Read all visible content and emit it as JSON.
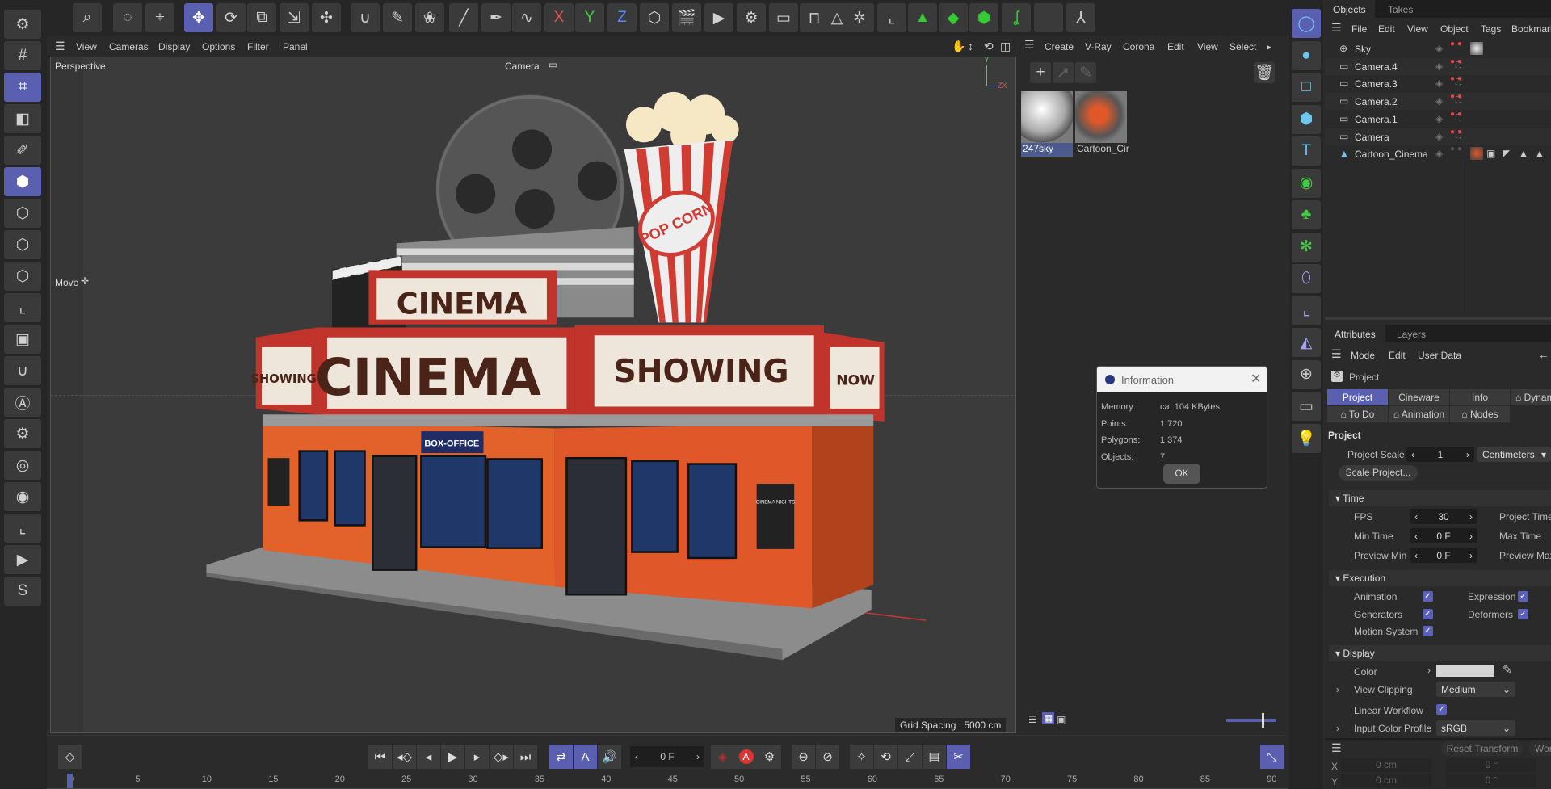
{
  "top_toolbar": [
    {
      "name": "search-icon",
      "g": "⌕"
    },
    {
      "name": "live-selection-icon",
      "g": "◌"
    },
    {
      "name": "selection-tool-icon",
      "g": "⌖"
    },
    {
      "name": "move-icon",
      "g": "✥",
      "active": true
    },
    {
      "name": "rotate-icon",
      "g": "⟳"
    },
    {
      "name": "scale-icon",
      "g": "⧉"
    },
    {
      "name": "snap-move-icon",
      "g": "⇲"
    },
    {
      "name": "transform-icon",
      "g": "✣"
    },
    {
      "name": "magnet-icon",
      "g": "∪"
    },
    {
      "name": "paint-icon",
      "g": "✎"
    },
    {
      "name": "weight-icon",
      "g": "❀"
    },
    {
      "name": "brush-icon",
      "g": "╱"
    },
    {
      "name": "pen-icon",
      "g": "✒"
    },
    {
      "name": "spline-icon",
      "g": "∿"
    },
    {
      "name": "x-axis-icon",
      "g": "X"
    },
    {
      "name": "y-axis-icon",
      "g": "Y"
    },
    {
      "name": "z-axis-icon",
      "g": "Z"
    },
    {
      "name": "coordinate-system-icon",
      "g": "⬡"
    },
    {
      "name": "render-view-icon",
      "g": "🎬"
    },
    {
      "name": "render-picture-viewer-icon",
      "g": "▶"
    },
    {
      "name": "render-settings-icon",
      "g": "⚙"
    },
    {
      "name": "render-queue-icon",
      "g": "▭"
    },
    {
      "name": "lock-icon",
      "g": "⊓"
    },
    {
      "name": "triangle-tag-icon",
      "g": "△"
    },
    {
      "name": "sparkle-icon",
      "g": "✲"
    },
    {
      "name": "axis-icon",
      "g": "⌞"
    },
    {
      "name": "green-pyramid-icon",
      "g": "▲"
    },
    {
      "name": "green-cube-icon",
      "g": "◆"
    },
    {
      "name": "green-cube2-icon",
      "g": "⬢"
    },
    {
      "name": "green-spline-icon",
      "g": "ʆ"
    },
    {
      "name": "empty-slot-icon",
      "g": ""
    },
    {
      "name": "figure-icon",
      "g": "⅄"
    }
  ],
  "left_toolbar": [
    {
      "name": "settings-icon",
      "g": "⚙"
    },
    {
      "name": "grid-icon",
      "g": "#"
    },
    {
      "name": "workplane-icon",
      "g": "⌗",
      "active": true
    },
    {
      "name": "model-mode-icon",
      "g": "◧"
    },
    {
      "name": "sculpt-icon",
      "g": "✐"
    },
    {
      "name": "object-mode-icon",
      "g": "⬢",
      "active": true
    },
    {
      "name": "points-mode-icon",
      "g": "⬡"
    },
    {
      "name": "edges-mode-icon",
      "g": "⬡"
    },
    {
      "name": "polygons-mode-icon",
      "g": "⬡"
    },
    {
      "name": "axis-mode-icon",
      "g": "⌞"
    },
    {
      "name": "texture-mode-icon",
      "g": "▣"
    },
    {
      "name": "magnet-snap-icon",
      "g": "∪"
    },
    {
      "name": "auto-snap-icon",
      "g": "Ⓐ"
    },
    {
      "name": "snap-settings-icon",
      "g": "⚙"
    },
    {
      "name": "symmetry-icon",
      "g": "◎"
    },
    {
      "name": "visibility-icon",
      "g": "◉"
    },
    {
      "name": "texture-axis-icon",
      "g": "⌞"
    },
    {
      "name": "render-region-icon",
      "g": "▶"
    },
    {
      "name": "s-plugin-icon",
      "g": "S"
    }
  ],
  "right_column": [
    {
      "name": "sky-object-icon",
      "g": "◯",
      "active": true
    },
    {
      "name": "null-object-icon",
      "g": "●"
    },
    {
      "name": "spline-rect-icon",
      "g": "□"
    },
    {
      "name": "cube-icon",
      "g": "⬢"
    },
    {
      "name": "text-icon",
      "g": "T"
    },
    {
      "name": "generator-icon",
      "g": "◉"
    },
    {
      "name": "cloner-icon",
      "g": "♣"
    },
    {
      "name": "effector-icon",
      "g": "✻"
    },
    {
      "name": "deformer-icon",
      "g": "⬯"
    },
    {
      "name": "field-icon",
      "g": "⌞"
    },
    {
      "name": "tag-icon",
      "g": "◭"
    },
    {
      "name": "environment-icon",
      "g": "⊕"
    },
    {
      "name": "camera-icon",
      "g": "▭"
    },
    {
      "name": "light-icon",
      "g": "💡"
    }
  ],
  "viewport": {
    "menu": [
      "View",
      "Cameras",
      "Display",
      "Options",
      "Filter",
      "Panel"
    ],
    "view_name": "Perspective",
    "camera": "Camera",
    "tool_label": "Move",
    "grid_spacing": "Grid Spacing : 5000 cm",
    "axis_y": "Y",
    "axis_zx": "ZX"
  },
  "scene": {
    "sign_main": "CINEMA",
    "sign_top": "CINEMA",
    "sign_showing": "SHOWING",
    "sign_left": "SHOWING",
    "sign_now": "NOW",
    "box_office": "BOX-OFFICE",
    "popcorn": "POP CORN",
    "poster": "CINEMA NIGHTS"
  },
  "materials": {
    "menu": [
      "Create",
      "V-Ray",
      "Corona",
      "Edit",
      "View",
      "Select"
    ],
    "items": [
      {
        "name": "247sky",
        "selected": true
      },
      {
        "name": "Cartoon_Cir"
      }
    ]
  },
  "info_dialog": {
    "title": "Information",
    "rows": [
      {
        "k": "Memory:",
        "v": "ca. 104 KBytes"
      },
      {
        "k": "Points:",
        "v": "1 720"
      },
      {
        "k": "Polygons:",
        "v": "1 374"
      },
      {
        "k": "Objects:",
        "v": "7"
      }
    ],
    "ok": "OK"
  },
  "objects": {
    "tabs": [
      "Objects",
      "Takes"
    ],
    "menu": [
      "File",
      "Edit",
      "View",
      "Object",
      "Tags",
      "Bookmarks"
    ],
    "rows": [
      {
        "name": "Sky",
        "icon": "⊕"
      },
      {
        "name": "Camera.4",
        "icon": "▭"
      },
      {
        "name": "Camera.3",
        "icon": "▭"
      },
      {
        "name": "Camera.2",
        "icon": "▭"
      },
      {
        "name": "Camera.1",
        "icon": "▭"
      },
      {
        "name": "Camera",
        "icon": "▭"
      },
      {
        "name": "Cartoon_Cinema",
        "icon": "▲"
      }
    ]
  },
  "attributes": {
    "tabs": [
      "Attributes",
      "Layers"
    ],
    "menu": [
      "Mode",
      "Edit",
      "User Data"
    ],
    "object": "Project",
    "subtabs1": [
      "Project",
      "Cineware",
      "Info",
      "⌂ Dynamics"
    ],
    "subtabs2": [
      "⌂ To Do",
      "⌂ Animation",
      "⌂ Nodes"
    ],
    "heading": "Project",
    "project_scale_label": "Project Scale",
    "project_scale": "1",
    "units": "Centimeters",
    "scale_button": "Scale Project...",
    "time": {
      "title": "Time",
      "fps_label": "FPS",
      "fps": "30",
      "min_label": "Min Time",
      "min": "0 F",
      "pmin_label": "Preview Min",
      "pmin": "0 F",
      "ptime_label": "Project Time",
      "max_label": "Max Time",
      "pmax_label": "Preview Max"
    },
    "execution": {
      "title": "Execution",
      "items": [
        "Animation",
        "Generators",
        "Motion System",
        "Expression",
        "Deformers"
      ]
    },
    "display": {
      "title": "Display",
      "color_label": "Color",
      "color": "#d4d4d4",
      "clip_label": "View Clipping",
      "clip": "Medium",
      "linear_label": "Linear Workflow",
      "input_label": "Input Color Profile",
      "input": "sRGB"
    }
  },
  "coords": {
    "reset": "Reset Transform",
    "world": "World",
    "x": "X",
    "y": "Y",
    "xpos": "0 cm",
    "ypos": "0 cm",
    "xrot": "0 °",
    "yrot": "0 °"
  },
  "timeline": {
    "frame": "0 F",
    "ticks": [
      "0",
      "5",
      "10",
      "15",
      "20",
      "25",
      "30",
      "35",
      "40",
      "45",
      "50",
      "55",
      "60",
      "65",
      "70",
      "75",
      "80",
      "85",
      "90"
    ],
    "current": 0
  }
}
